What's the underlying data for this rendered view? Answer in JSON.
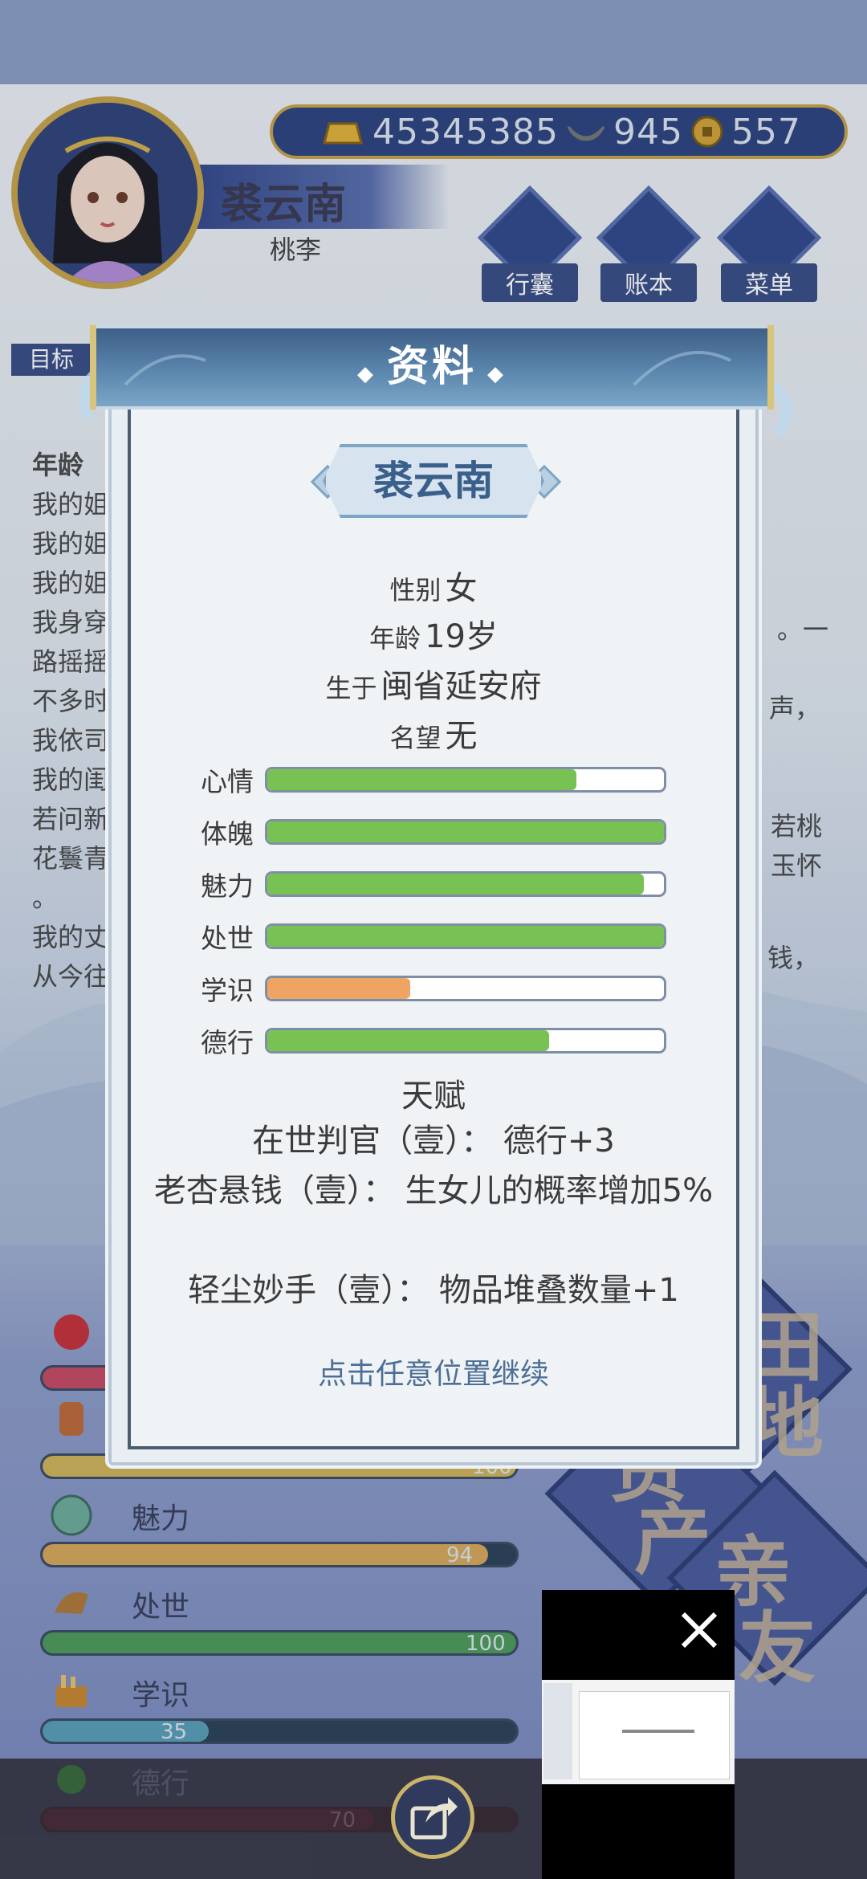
{
  "header": {
    "name": "裘云南",
    "subtitle": "桃李",
    "currency": {
      "gold": "45345385",
      "silver": "945",
      "coin": "557"
    },
    "buttons": [
      {
        "label": "行囊",
        "icon": "bag-icon"
      },
      {
        "label": "账本",
        "icon": "ledger-icon"
      },
      {
        "label": "菜单",
        "icon": "menu-dots-icon"
      }
    ],
    "goal_label": "目标"
  },
  "story": {
    "lines": [
      "年龄",
      "我的姐",
      "我的姐",
      "我的姐",
      "我身穿",
      "路摇摇",
      "不多时",
      "我依司",
      "我的闺",
      "若问新",
      "花鬟青",
      "。",
      "我的丈",
      "从今往"
    ],
    "right_fragments": [
      "。一",
      "声，",
      "若桃",
      "玉怀",
      "钱，"
    ]
  },
  "background_stats": [
    {
      "label": "魅力",
      "value": "94",
      "level": 0.94,
      "color": "#d9a85a"
    },
    {
      "label": "处世",
      "value": "100",
      "level": 1.0,
      "color": "#4f9a5a"
    },
    {
      "label": "学识",
      "value": "35",
      "level": 0.35,
      "color": "#5b9fb8"
    },
    {
      "label": "德行",
      "value": "70",
      "level": 0.7,
      "color": "#8a3a4a"
    }
  ],
  "background_partial": {
    "top_value": "100"
  },
  "background_big_text": [
    "田",
    "地",
    "资",
    "产",
    "亲",
    "友"
  ],
  "modal": {
    "title": "资料",
    "name": "裘云南",
    "gender_label": "性别",
    "gender": "女",
    "age_label": "年龄",
    "age": "19岁",
    "birthplace_label": "生于",
    "birthplace": "闽省延安府",
    "reputation_label": "名望",
    "reputation": "无",
    "attributes": [
      {
        "label": "心情",
        "level": 0.78,
        "color": "#78c153"
      },
      {
        "label": "体魄",
        "level": 1.0,
        "color": "#78c153"
      },
      {
        "label": "魅力",
        "level": 0.95,
        "color": "#78c153"
      },
      {
        "label": "处世",
        "level": 1.0,
        "color": "#78c153"
      },
      {
        "label": "学识",
        "level": 0.36,
        "color": "#f0a463"
      },
      {
        "label": "德行",
        "level": 0.71,
        "color": "#78c153"
      }
    ],
    "talent_title": "天赋",
    "talents": [
      "在世判官（壹）： 德行+3",
      "老杏悬钱（壹）： 生女儿的概率增加5%",
      "轻尘妙手（壹）： 物品堆叠数量+1"
    ],
    "continue_hint": "点击任意位置继续"
  },
  "colors": {
    "accent_blue": "#3a5f8a",
    "bar_green": "#78c153",
    "bar_orange": "#f0a463",
    "gold_trim": "#c9a44a"
  }
}
